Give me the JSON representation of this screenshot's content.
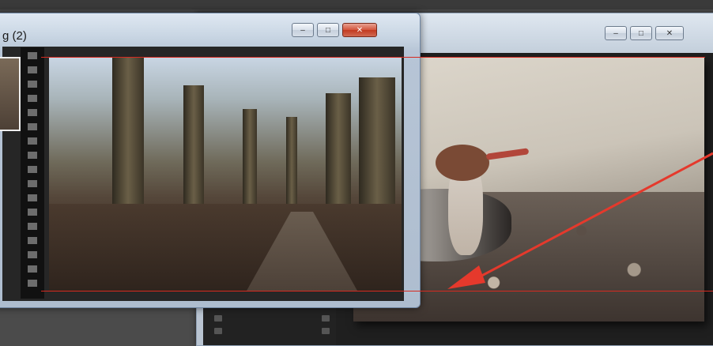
{
  "front_window": {
    "title": "g (2)",
    "controls": {
      "minimize": "–",
      "maximize": "□",
      "close": "✕"
    }
  },
  "back_window": {
    "controls": {
      "minimize": "–",
      "maximize": "□",
      "close": "✕"
    }
  },
  "images": {
    "forest": "forest path photo",
    "bird": "merganser on pebble beach photo"
  },
  "colors": {
    "guide_line": "#d62a20",
    "arrow": "#e5392c",
    "close_button": "#c9452c"
  },
  "icons": [
    "minimize-icon",
    "maximize-icon",
    "close-icon",
    "arrow-annotation"
  ]
}
